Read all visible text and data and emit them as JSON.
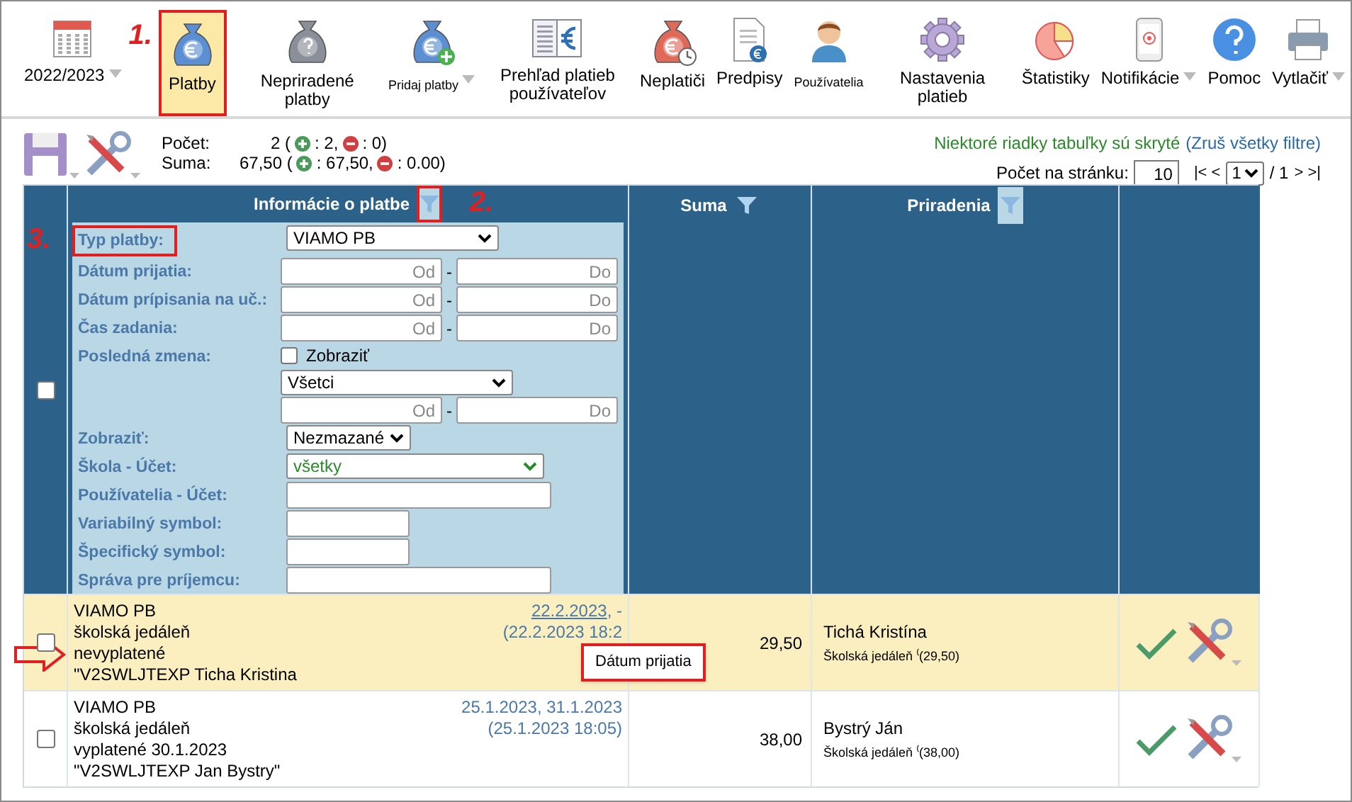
{
  "toolbar": {
    "items": [
      {
        "label": "2022/2023",
        "selected": false,
        "has_menu": true,
        "small": false
      },
      {
        "label": "Platby",
        "selected": true,
        "has_menu": false,
        "small": false,
        "annotation": "1."
      },
      {
        "label": "Nepriradené platby",
        "selected": false,
        "has_menu": false,
        "small": false
      },
      {
        "label": "Pridaj platby",
        "selected": false,
        "has_menu": true,
        "small": true
      },
      {
        "label": "Prehľad platieb používateľov",
        "selected": false,
        "has_menu": false,
        "small": false
      },
      {
        "label": "Neplatiči",
        "selected": false,
        "has_menu": false,
        "small": false
      },
      {
        "label": "Predpisy",
        "selected": false,
        "has_menu": false,
        "small": false
      },
      {
        "label": "Používatelia",
        "selected": false,
        "has_menu": false,
        "small": true
      },
      {
        "label": "Nastavenia platieb",
        "selected": false,
        "has_menu": false,
        "small": false
      },
      {
        "label": "Štatistiky",
        "selected": false,
        "has_menu": false,
        "small": false
      },
      {
        "label": "Notifikácie",
        "selected": false,
        "has_menu": true,
        "small": false
      },
      {
        "label": "Pomoc",
        "selected": false,
        "has_menu": false,
        "small": false
      },
      {
        "label": "Vytlačiť",
        "selected": false,
        "has_menu": true,
        "small": false
      }
    ]
  },
  "summary": {
    "rows": [
      {
        "label": "Počet:",
        "total": "2 (",
        "plus": ": 2,",
        "minus": ": 0)"
      },
      {
        "label": "Suma:",
        "total": "67,50 (",
        "plus": ": 67,50,",
        "minus": ": 0.00)"
      }
    ]
  },
  "notice": {
    "text": "Niektoré riadky tabuľky sú skryté",
    "link": "(Zruš všetky filtre)"
  },
  "paging": {
    "label": "Počet na stránku:",
    "per_page": "10",
    "first_prev": "|< <",
    "page": "1",
    "of": "/ 1",
    "next_last": "> >|"
  },
  "table": {
    "columns": [
      {
        "label": "Informácie o platbe",
        "filter_active": true,
        "annotation": "2."
      },
      {
        "label": "Suma",
        "filter_active": false
      },
      {
        "label": "Priradenia",
        "filter_active": true
      }
    ],
    "select_all_checked": false,
    "filters": [
      {
        "label": "Typ platby:",
        "kind": "select",
        "value": "VIAMO PB",
        "annotation": "3."
      },
      {
        "label": "Dátum prijatia:",
        "kind": "range",
        "from_placeholder": "Od",
        "separator": "-",
        "to_placeholder": "Do"
      },
      {
        "label": "Dátum prípisania na uč.:",
        "kind": "range",
        "from_placeholder": "Od",
        "separator": "-",
        "to_placeholder": "Do"
      },
      {
        "label": "Čas zadania:",
        "kind": "range",
        "from_placeholder": "Od",
        "separator": "-",
        "to_placeholder": "Do"
      },
      {
        "label": "Posledná zmena:",
        "kind": "change",
        "checkbox_label": "Zobraziť",
        "checked": false,
        "value": "Všetci",
        "from_placeholder": "Od",
        "separator": "-",
        "to_placeholder": "Do"
      },
      {
        "label": "Zobraziť:",
        "kind": "small_select",
        "value": "Nezmazané"
      },
      {
        "label": "Škola - Účet:",
        "kind": "green_select",
        "value": "všetky"
      },
      {
        "label": "Používatelia - Účet:",
        "kind": "wide_text"
      },
      {
        "label": "Variabilný symbol:",
        "kind": "short_text"
      },
      {
        "label": "Špecifický symbol:",
        "kind": "short_text"
      },
      {
        "label": "Správa pre príjemcu:",
        "kind": "wide_text"
      }
    ],
    "rows": [
      {
        "selected": true,
        "checked": false,
        "pointer": true,
        "lines": [
          "VIAMO PB",
          "školská jedáleň",
          "nevyplatené",
          "\"V2SWLJTEXP Ticha Kristina"
        ],
        "date_link": "22.2.2023",
        "hovered": true,
        "date_rest": ", -",
        "created": "(22.2.2023 18:2",
        "amount": "29,50",
        "assignee": "Tichá Kristína",
        "assignee_detail": "Školská jedáleň ⁽(29,50)"
      },
      {
        "selected": false,
        "checked": false,
        "pointer": false,
        "lines": [
          "VIAMO PB",
          "školská jedáleň",
          "vyplatené 30.1.2023",
          "\"V2SWLJTEXP Jan Bystry\""
        ],
        "date_link": "25.1.2023",
        "hovered": false,
        "date_rest": ", 31.1.2023",
        "created": "(25.1.2023 18:05)",
        "amount": "38,00",
        "assignee": "Bystrý Ján",
        "assignee_detail": "Školská jedáleň ⁽(38,00)"
      }
    ]
  },
  "tooltip": {
    "text": "Dátum prijatia"
  }
}
